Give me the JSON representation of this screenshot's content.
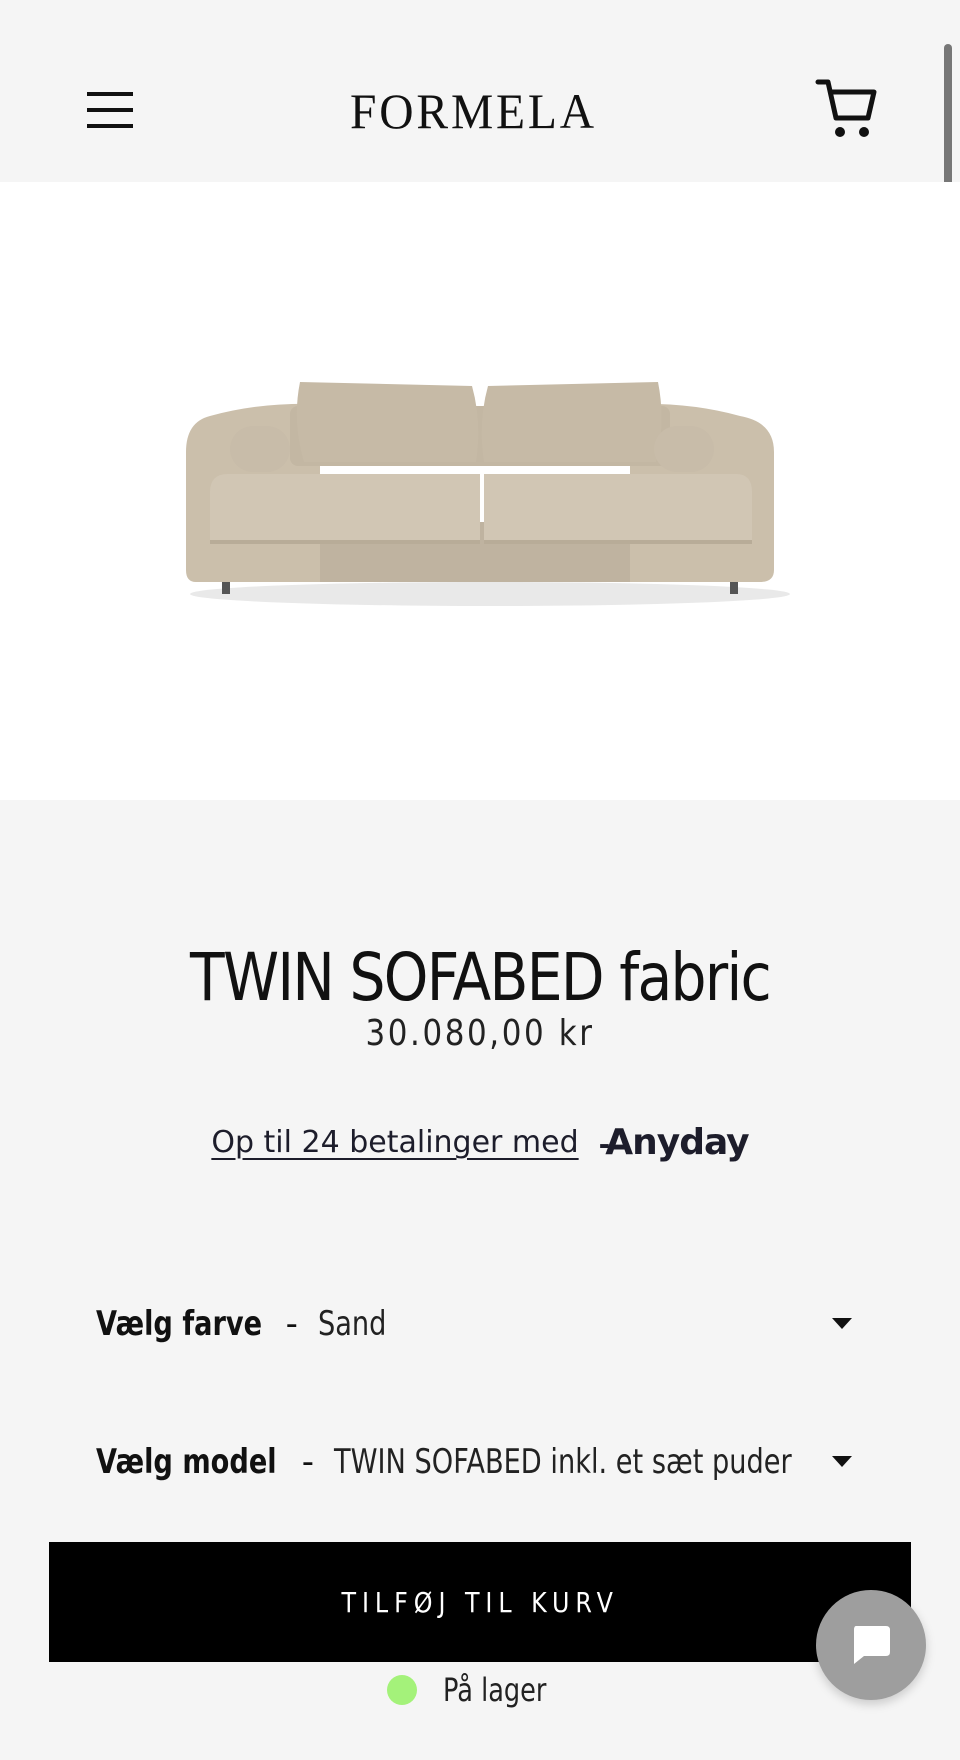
{
  "header": {
    "logo_text": "FORMELA",
    "menu_icon": "hamburger-menu-icon",
    "cart_icon": "shopping-cart-icon"
  },
  "product": {
    "title": "TWIN SOFABED fabric",
    "price": "30.080,00 kr",
    "image_desc_icon": "sofa-image",
    "sofa_color": "#c8bca9"
  },
  "payment": {
    "link_text": "Op til 24 betalinger med",
    "brand": "Anyday"
  },
  "options": {
    "color": {
      "label": "Vælg farve",
      "separator": "-",
      "value": "Sand"
    },
    "model": {
      "label": "Vælg model",
      "separator": "-",
      "value": "TWIN SOFABED inkl. et sæt puder"
    }
  },
  "actions": {
    "add_to_cart": "TILFØJ TIL KURV"
  },
  "stock": {
    "text": "På lager",
    "status_color": "#a4f27a"
  },
  "chat": {
    "icon": "chat-bubble-icon"
  }
}
